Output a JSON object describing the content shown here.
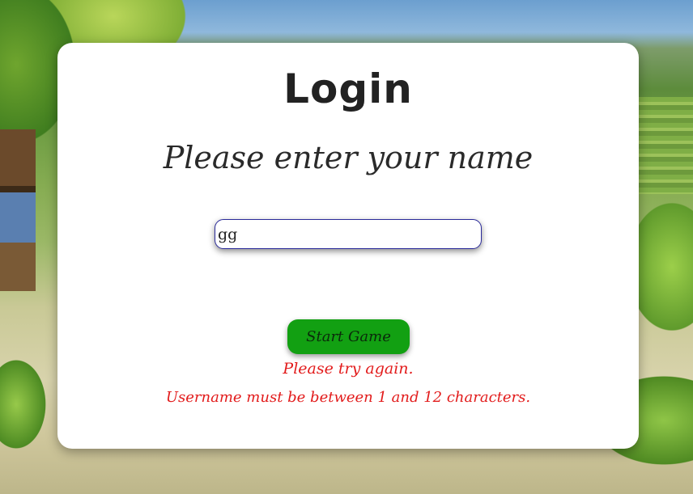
{
  "login": {
    "title": "Login",
    "subtitle": "Please enter your name",
    "name_input_value": "gg",
    "start_button_label": "Start Game",
    "error_message": "Please try again.",
    "validation_message": "Username must be between 1 and 12 characters."
  },
  "colors": {
    "card_background": "#ffffff",
    "button_background": "#12a012",
    "error_text": "#e21b1b",
    "input_border": "#2a2a9a"
  }
}
